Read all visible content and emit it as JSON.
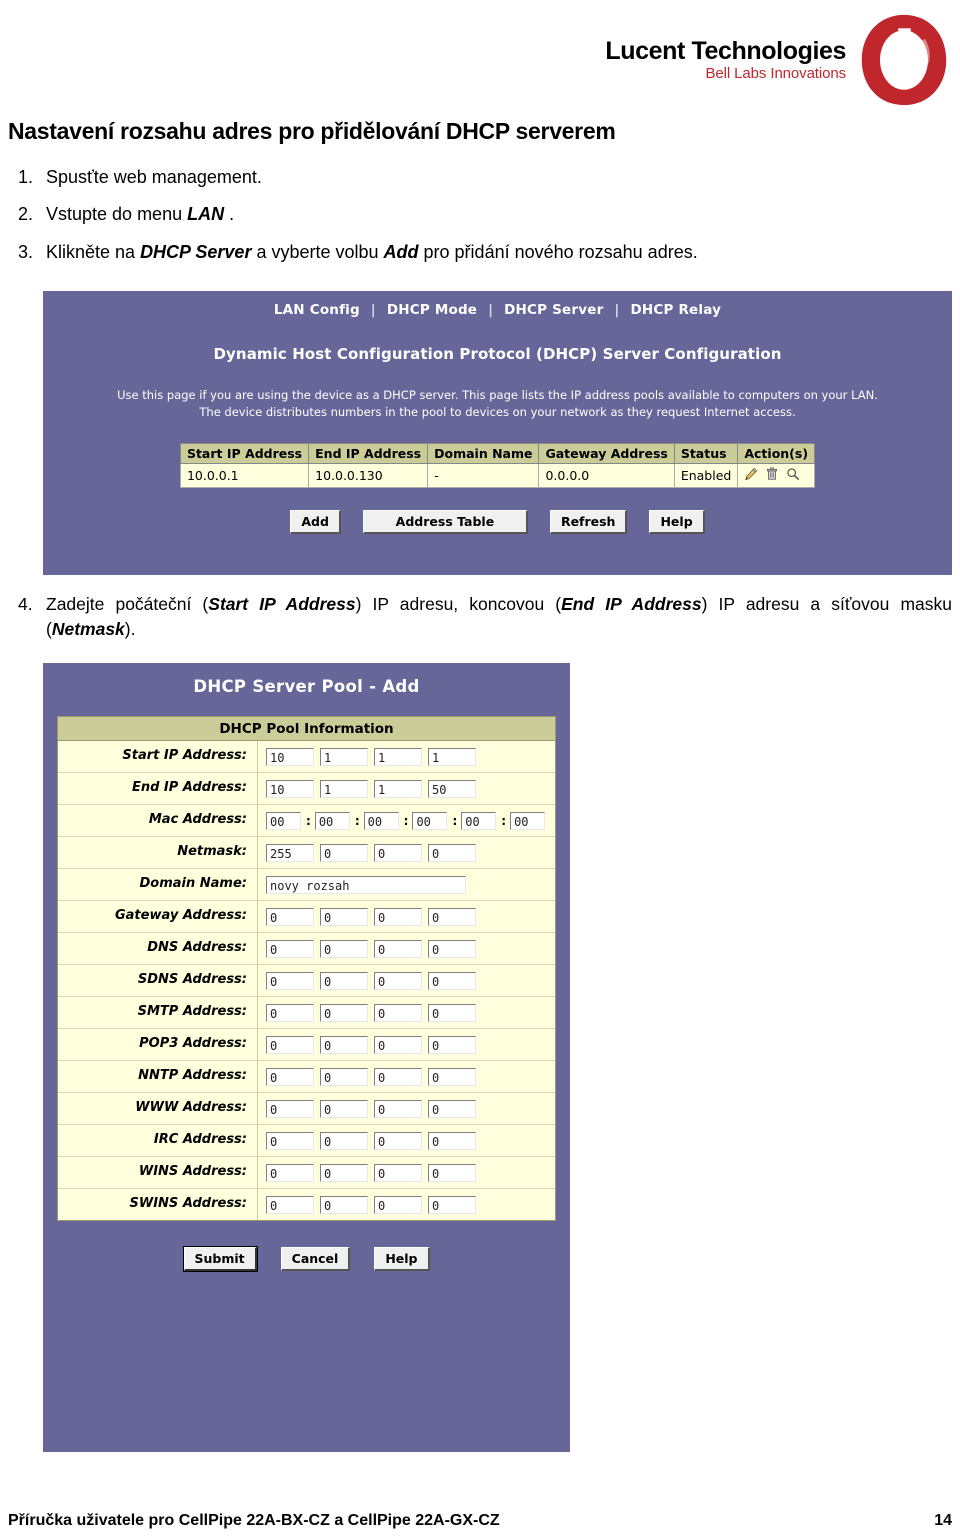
{
  "logo": {
    "title": "Lucent Technologies",
    "subtitle": "Bell Labs Innovations",
    "mark_name": "lucent-ring-logo",
    "brand_red": "#c0272d"
  },
  "document": {
    "heading": "Nastavení rozsahu adres pro přidělování DHCP serverem",
    "steps": [
      {
        "num": "1.",
        "html": "Spusťte web management."
      },
      {
        "num": "2.",
        "html": "Vstupte do menu <b>LAN</b> ."
      },
      {
        "num": "3.",
        "html": "Klikněte na <b>DHCP Server</b> a vyberte volbu <b>Add</b> pro přidání nového rozsahu adres."
      }
    ],
    "step4": {
      "num": "4.",
      "html": "Zadejte počáteční (<b>Start IP Address</b>) IP adresu, koncovou (<b>End IP Address</b>) IP adresu a síťovou masku (<b>Netmask</b>)."
    },
    "footer": {
      "left": "Příručka uživatele pro CellPipe 22A-BX-CZ a CellPipe 22A-GX-CZ",
      "page": "14"
    }
  },
  "theme": {
    "panel_purple": "#666699",
    "table_header": "#cccc99",
    "table_body": "#ffffdd",
    "button_face": "#f0f0f0"
  },
  "dhcp_server_page": {
    "tabs": [
      "LAN Config",
      "DHCP Mode",
      "DHCP Server",
      "DHCP Relay"
    ],
    "tab_separator": "|",
    "title": "Dynamic Host Configuration Protocol (DHCP) Server Configuration",
    "description_line1": "Use this page if you are using the device as a DHCP server. This page lists the IP address pools available to computers on your LAN.",
    "description_line2": "The device distributes numbers in the pool to devices on your network as they request Internet access.",
    "table": {
      "columns": [
        "Start IP Address",
        "End IP Address",
        "Domain Name",
        "Gateway Address",
        "Status",
        "Action(s)"
      ],
      "rows": [
        {
          "start_ip": "10.0.0.1",
          "end_ip": "10.0.0.130",
          "domain_name": "-",
          "gateway": "0.0.0.0",
          "status": "Enabled",
          "actions": [
            "edit-pencil-icon",
            "delete-trash-icon",
            "view-magnifier-icon"
          ]
        }
      ]
    },
    "buttons": [
      "Add",
      "Address Table",
      "Refresh",
      "Help"
    ]
  },
  "pool_add_page": {
    "title": "DHCP Server Pool - Add",
    "section_header": "DHCP Pool Information",
    "fields": [
      {
        "label": "Start IP Address:",
        "type": "octets",
        "values": [
          "10",
          "1",
          "1",
          "1"
        ]
      },
      {
        "label": "End IP Address:",
        "type": "octets",
        "values": [
          "10",
          "1",
          "1",
          "50"
        ]
      },
      {
        "label": "Mac Address:",
        "type": "mac",
        "values": [
          "00",
          "00",
          "00",
          "00",
          "00",
          "00"
        ],
        "separator": ":"
      },
      {
        "label": "Netmask:",
        "type": "octets",
        "values": [
          "255",
          "0",
          "0",
          "0"
        ]
      },
      {
        "label": "Domain Name:",
        "type": "text",
        "values": [
          "novy rozsah"
        ]
      },
      {
        "label": "Gateway Address:",
        "type": "octets",
        "values": [
          "0",
          "0",
          "0",
          "0"
        ]
      },
      {
        "label": "DNS Address:",
        "type": "octets",
        "values": [
          "0",
          "0",
          "0",
          "0"
        ]
      },
      {
        "label": "SDNS Address:",
        "type": "octets",
        "values": [
          "0",
          "0",
          "0",
          "0"
        ]
      },
      {
        "label": "SMTP Address:",
        "type": "octets",
        "values": [
          "0",
          "0",
          "0",
          "0"
        ]
      },
      {
        "label": "POP3 Address:",
        "type": "octets",
        "values": [
          "0",
          "0",
          "0",
          "0"
        ]
      },
      {
        "label": "NNTP Address:",
        "type": "octets",
        "values": [
          "0",
          "0",
          "0",
          "0"
        ]
      },
      {
        "label": "WWW Address:",
        "type": "octets",
        "values": [
          "0",
          "0",
          "0",
          "0"
        ]
      },
      {
        "label": "IRC Address:",
        "type": "octets",
        "values": [
          "0",
          "0",
          "0",
          "0"
        ]
      },
      {
        "label": "WINS Address:",
        "type": "octets",
        "values": [
          "0",
          "0",
          "0",
          "0"
        ]
      },
      {
        "label": "SWINS Address:",
        "type": "octets",
        "values": [
          "0",
          "0",
          "0",
          "0"
        ]
      }
    ],
    "buttons": [
      "Submit",
      "Cancel",
      "Help"
    ]
  }
}
